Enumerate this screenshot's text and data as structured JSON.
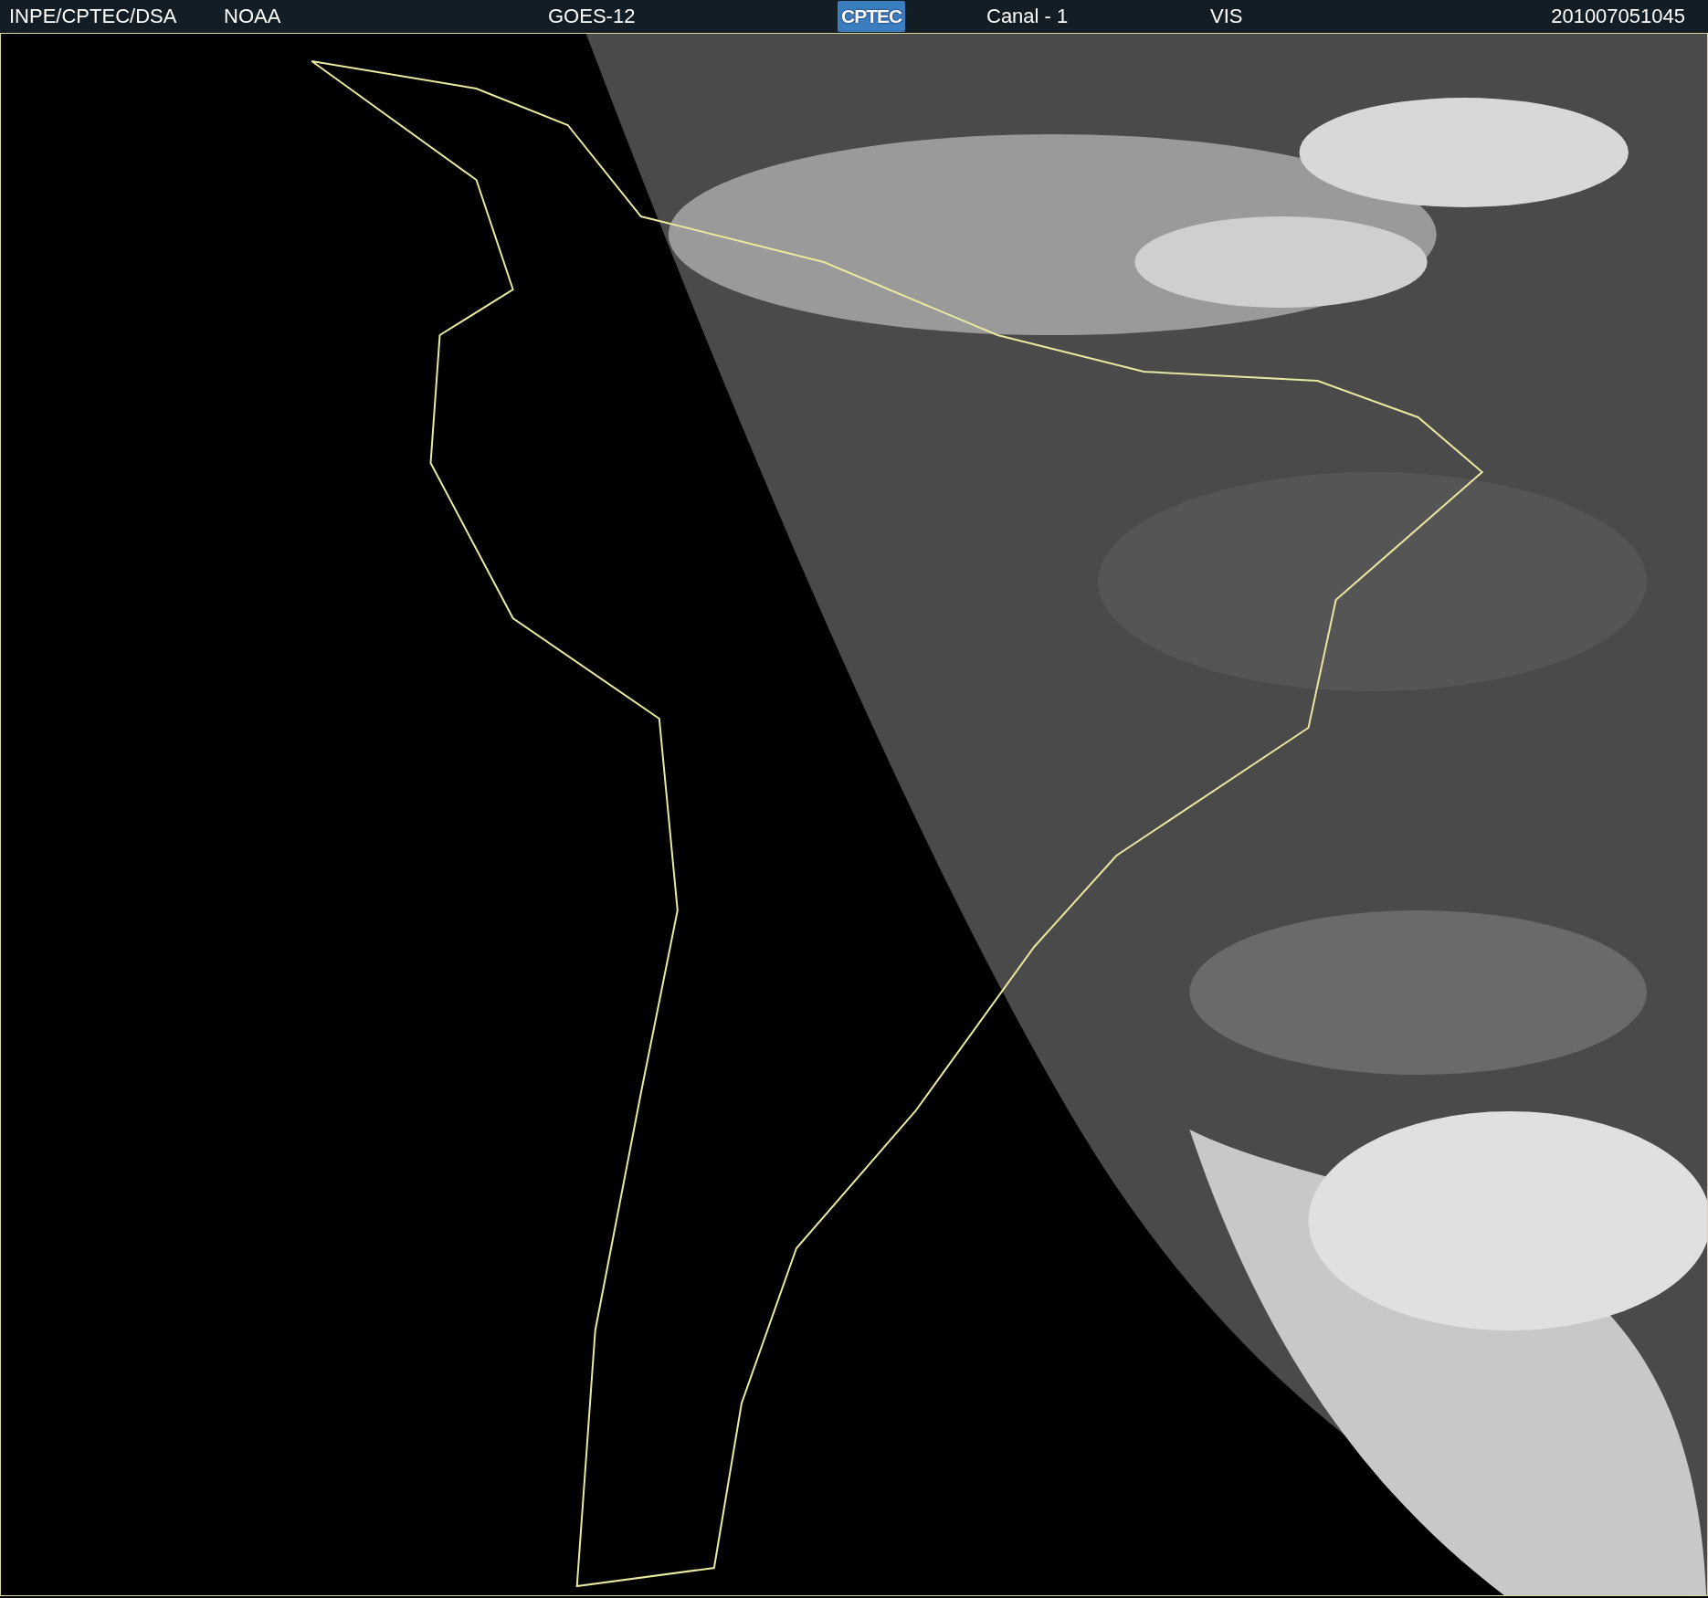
{
  "header": {
    "items": [
      {
        "kind": "text",
        "text": "INPE/CPTEC/DSA"
      },
      {
        "kind": "text",
        "text": "NOAA"
      },
      {
        "kind": "text",
        "text": "GOES-12"
      },
      {
        "kind": "logo",
        "text": "CPTEC"
      },
      {
        "kind": "text",
        "text": "Canal - 1"
      },
      {
        "kind": "text",
        "text": "VIS"
      },
      {
        "kind": "text",
        "text": "201007051045"
      }
    ]
  }
}
